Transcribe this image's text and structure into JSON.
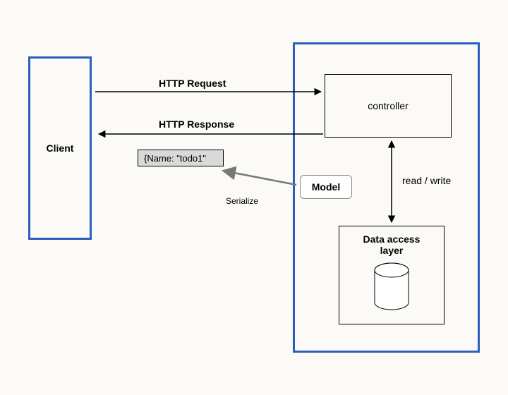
{
  "client": {
    "label": "Client"
  },
  "server": {
    "controller_label": "controller",
    "data_access_label": "Data access\nlayer",
    "readwrite_label": "read / write"
  },
  "arrows": {
    "request_label": "HTTP Request",
    "response_label": "HTTP Response",
    "serialize_label": "Serialize"
  },
  "model": {
    "label": "Model"
  },
  "payload": {
    "text": "{Name: \"todo1\""
  }
}
